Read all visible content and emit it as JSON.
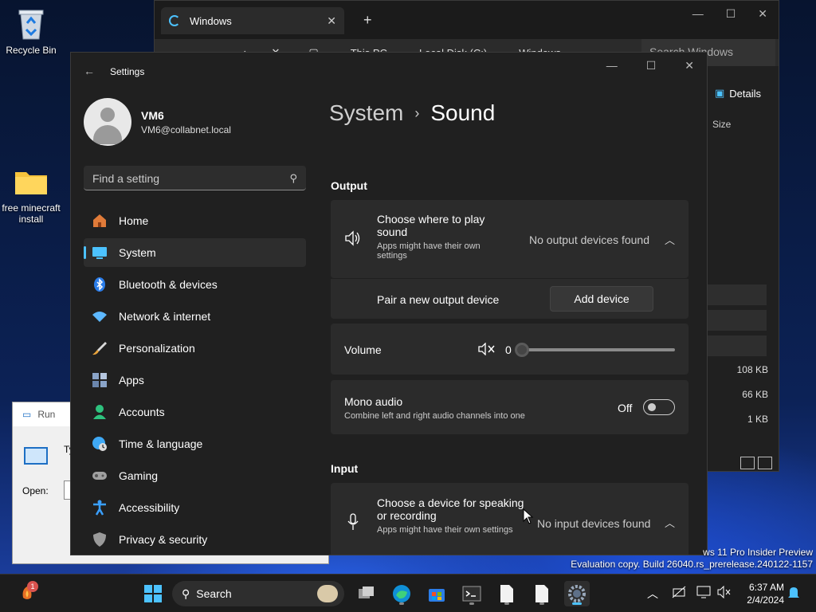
{
  "desktop": {
    "icons": [
      {
        "label": "Recycle Bin"
      },
      {
        "label": "free minecraft install"
      }
    ]
  },
  "explorer": {
    "tab_title": "Windows",
    "breadcrumb": [
      "This PC",
      "Local Disk (C:)",
      "Windows"
    ],
    "search_placeholder": "Search Windows",
    "details_label": "Details",
    "size_header": "Size",
    "sizes": [
      "108 KB",
      "66 KB",
      "1 KB"
    ]
  },
  "run": {
    "title": "Run",
    "body_text": "Ty re",
    "open_label": "Open:"
  },
  "settings": {
    "app_title": "Settings",
    "user": {
      "name": "VM6",
      "email": "VM6@collabnet.local"
    },
    "search_placeholder": "Find a setting",
    "nav": [
      {
        "label": "Home",
        "icon": "home-icon",
        "color": "#e07b39"
      },
      {
        "label": "System",
        "icon": "system-icon",
        "color": "#4cc2ff",
        "active": true
      },
      {
        "label": "Bluetooth & devices",
        "icon": "bluetooth-icon",
        "color": "#2b7de9"
      },
      {
        "label": "Network & internet",
        "icon": "wifi-icon",
        "color": "#5db8ff"
      },
      {
        "label": "Personalization",
        "icon": "brush-icon",
        "color": "#e8a33c"
      },
      {
        "label": "Apps",
        "icon": "apps-icon",
        "color": "#8aa4c8"
      },
      {
        "label": "Accounts",
        "icon": "accounts-icon",
        "color": "#2ec27e"
      },
      {
        "label": "Time & language",
        "icon": "globe-clock-icon",
        "color": "#3fa9f5"
      },
      {
        "label": "Gaming",
        "icon": "gamepad-icon",
        "color": "#a0a0a0"
      },
      {
        "label": "Accessibility",
        "icon": "accessibility-icon",
        "color": "#3aa0ff"
      },
      {
        "label": "Privacy & security",
        "icon": "shield-icon",
        "color": "#9a9a9a"
      }
    ],
    "breadcrumb": {
      "parent": "System",
      "current": "Sound"
    },
    "output": {
      "heading": "Output",
      "choose_title": "Choose where to play sound",
      "choose_sub": "Apps might have their own settings",
      "status": "No output devices found",
      "pair_label": "Pair a new output device",
      "add_button": "Add device",
      "volume_label": "Volume",
      "volume_value": "0",
      "mono_title": "Mono audio",
      "mono_sub": "Combine left and right audio channels into one",
      "mono_state": "Off"
    },
    "input": {
      "heading": "Input",
      "choose_title": "Choose a device for speaking or recording",
      "choose_sub": "Apps might have their own settings",
      "status": "No input devices found"
    }
  },
  "watermark": {
    "line1": "ws 11 Pro Insider Preview",
    "line2": "Evaluation copy. Build 26040.rs_prerelease.240122-1157"
  },
  "taskbar": {
    "search_label": "Search",
    "badge": "1",
    "time": "6:37 AM",
    "date": "2/4/2024"
  }
}
